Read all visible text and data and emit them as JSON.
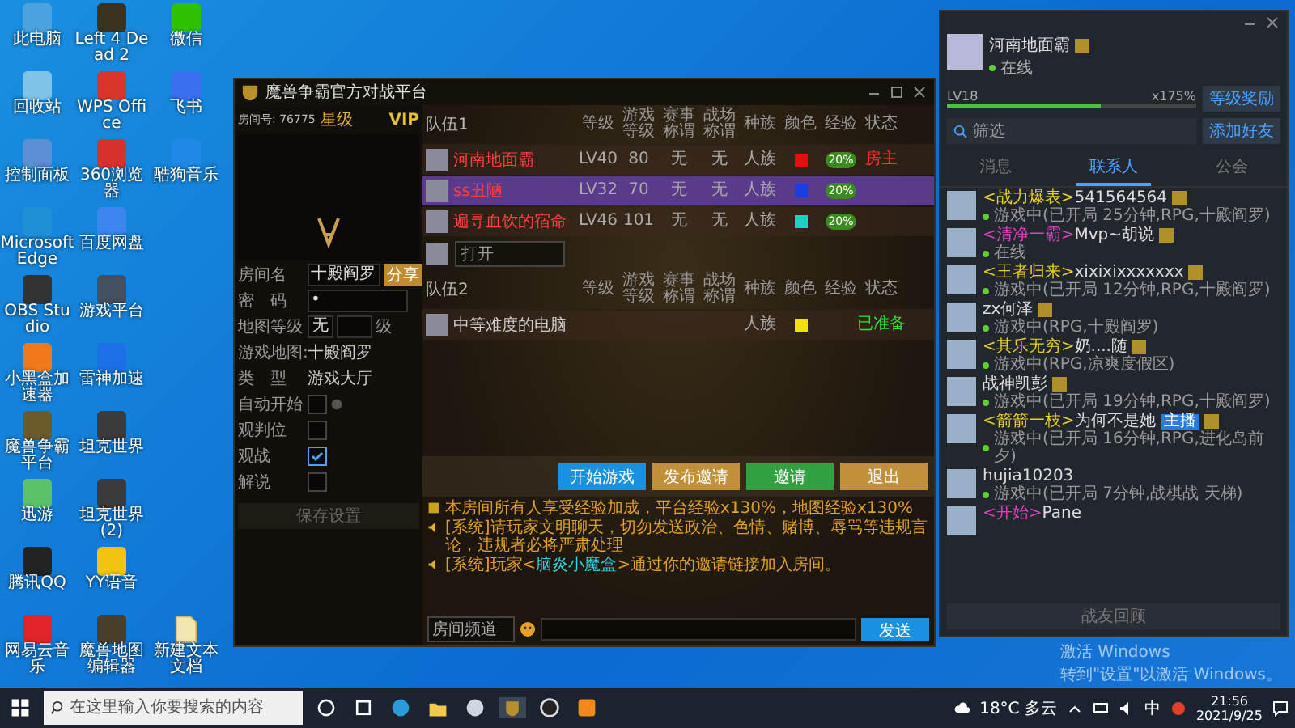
{
  "desktop": {
    "icons": [
      {
        "label": "此电脑",
        "color": "#4aa3df"
      },
      {
        "label": "回收站",
        "color": "#7fc4e8"
      },
      {
        "label": "控制面板",
        "color": "#5b8fd6"
      },
      {
        "label": "Microsoft Edge",
        "color": "#1f8fd6"
      },
      {
        "label": "OBS Studio",
        "color": "#333333"
      },
      {
        "label": "小黑盒加速器",
        "color": "#f07a1a"
      },
      {
        "label": "魔兽争霸平台",
        "color": "#6b5a2a"
      },
      {
        "label": "迅游",
        "color": "#5cc26a"
      },
      {
        "label": "腾讯QQ",
        "color": "#222222"
      },
      {
        "label": "网易云音乐",
        "color": "#e0252a"
      },
      {
        "label": "Left 4 Dead 2",
        "color": "#3a3320"
      },
      {
        "label": "WPS Office",
        "color": "#d9352b"
      },
      {
        "label": "360浏览器",
        "color": "#d8302a"
      },
      {
        "label": "百度网盘",
        "color": "#3b86f0"
      },
      {
        "label": "游戏平台",
        "color": "#44505e"
      },
      {
        "label": "雷神加速",
        "color": "#1c6fe6"
      },
      {
        "label": "坦克世界",
        "color": "#3b3b3b"
      },
      {
        "label": "坦克世界 (2)",
        "color": "#3b3b3b"
      },
      {
        "label": "YY语音",
        "color": "#f1c40f"
      },
      {
        "label": "魔兽地图编辑器",
        "color": "#4a3f2a"
      },
      {
        "label": "微信",
        "color": "#2dc100"
      },
      {
        "label": "飞书",
        "color": "#3a6ff0"
      },
      {
        "label": "酷狗音乐",
        "color": "#1e88e5"
      }
    ],
    "file": {
      "label": "新建文本文档"
    }
  },
  "game_window": {
    "title": "魔兽争霸官方对战平台",
    "room": {
      "number_label": "房间号:",
      "number": "76775",
      "star": "星级",
      "vip": "VIP"
    },
    "settings": {
      "name_label": "房间名",
      "name": "十殿阎罗",
      "share": "分享",
      "password_label": "密　码",
      "password": "•",
      "map_level_label": "地图等级",
      "map_level": "无",
      "map_level_unit": "级",
      "map_label": "游戏地图:",
      "map": "十殿阎罗",
      "type_label": "类　型",
      "type": "游戏大厅",
      "options": [
        {
          "label": "自动开始",
          "checked": false,
          "help": true
        },
        {
          "label": "观判位",
          "checked": false,
          "help": false
        },
        {
          "label": "观战",
          "checked": true,
          "help": false
        },
        {
          "label": "解说",
          "checked": false,
          "help": false
        }
      ],
      "save": "保存设置"
    },
    "teams": [
      {
        "name": "队伍1",
        "columns": [
          "等级",
          "游戏等级",
          "赛事称谓",
          "战场称谓",
          "种族",
          "颜色",
          "经验",
          "状态"
        ],
        "players": [
          {
            "name": "河南地面霸",
            "level": "LV40",
            "game_level": "80",
            "event_title": "无",
            "field_title": "无",
            "race": "人族",
            "color": "#e01010",
            "exp": "20%",
            "status": "房主",
            "kind": "host",
            "selected": false
          },
          {
            "name": "ss丑陋",
            "level": "LV32",
            "game_level": "70",
            "event_title": "无",
            "field_title": "无",
            "race": "人族",
            "color": "#1a3ee0",
            "exp": "20%",
            "selected": true
          },
          {
            "name": "遍寻血饮的宿命",
            "level": "LV46",
            "game_level": "101",
            "event_title": "无",
            "field_title": "无",
            "race": "人族",
            "color": "#20d0c0",
            "exp": "20%",
            "selected": false
          }
        ],
        "open_slot": "打开"
      },
      {
        "name": "队伍2",
        "columns": [
          "等级",
          "游戏等级",
          "赛事称谓",
          "战场称谓",
          "种族",
          "颜色",
          "经验",
          "状态"
        ],
        "players": [
          {
            "name": "中等难度的电脑",
            "race": "人族",
            "color": "#f0e010",
            "status": "已准备",
            "kind": "ready",
            "selected": false
          }
        ]
      }
    ],
    "buttons": [
      {
        "label": "开始游戏",
        "kind": "blue"
      },
      {
        "label": "发布邀请",
        "kind": "gold"
      },
      {
        "label": "邀请",
        "kind": "green"
      },
      {
        "label": "退出",
        "kind": "gold"
      }
    ],
    "messages": [
      {
        "kind": "bonus",
        "parts": [
          {
            "text": "本房间所有人享受经验加成，平台经验x130%，地图经验x130%"
          }
        ]
      },
      {
        "kind": "system",
        "parts": [
          {
            "text": "[系统]请玩家文明聊天，切勿发送政治、色情、赌博、辱骂等违规言论，违规者必将严肃处理"
          }
        ]
      },
      {
        "kind": "system",
        "parts": [
          {
            "text": "[系统]玩家<"
          },
          {
            "text": "脑炎小魔盒",
            "kind": "player"
          },
          {
            "text": ">通过你的邀请链接加入房间。"
          }
        ]
      }
    ],
    "channel": "房间频道",
    "send": "发送"
  },
  "friends_panel": {
    "profile": {
      "name": "河南地面霸",
      "status": "在线"
    },
    "level_label": "LV18",
    "bonus": "x175%",
    "level": 0.62,
    "reward": "等级奖励",
    "search": {
      "placeholder": "筛选"
    },
    "add_friend": "添加好友",
    "tabs": [
      {
        "label": "消息",
        "selected": false
      },
      {
        "label": "联系人",
        "selected": true
      },
      {
        "label": "公会",
        "selected": false
      }
    ],
    "contacts": [
      {
        "tag": "<战力爆表>",
        "color": "#e8d020",
        "name": "541564564",
        "vip": true,
        "status": "游戏中(已开局 25分钟,RPG,十殿阎罗)"
      },
      {
        "tag": "<清净一霸>",
        "color": "#e040c0",
        "name": "Mvp~胡说",
        "vip": true,
        "status": "在线"
      },
      {
        "tag": "<王者归来>",
        "color": "#e8d020",
        "name": "xixixixxxxxxx",
        "vip": true,
        "status": "游戏中(已开局 12分钟,RPG,十殿阎罗)"
      },
      {
        "name": "zx何泽",
        "vip": true,
        "status": "游戏中(RPG,十殿阎罗)"
      },
      {
        "tag": "<其乐无穷>",
        "color": "#e8d020",
        "name": "奶....随",
        "vip": true,
        "status": "游戏中(RPG,凉爽度假区)"
      },
      {
        "name": "战神凯彭",
        "vip": true,
        "status": "游戏中(已开局 19分钟,RPG,十殿阎罗)"
      },
      {
        "tag": "<箭箭一枝>",
        "color": "#e8d020",
        "name": "为何不是她",
        "badge": "主播",
        "vip": true,
        "status": "游戏中(已开局 16分钟,RPG,进化岛前夕)"
      },
      {
        "name": "hujia10203",
        "vip": false,
        "status": "游戏中(已开局 7分钟,战棋战 天梯)"
      },
      {
        "tag": "<开始>",
        "color": "#e040c0",
        "name": "Pane",
        "vip": false
      }
    ],
    "footer": "战友回顾"
  },
  "activation": {
    "title": "激活 Windows",
    "hint": "转到\"设置\"以激活 Windows。"
  },
  "taskbar": {
    "search": {
      "placeholder": "在这里输入你要搜索的内容"
    },
    "weather": "18°C 多云",
    "ime": "中",
    "time": "21:56",
    "date": "2021/9/25"
  }
}
